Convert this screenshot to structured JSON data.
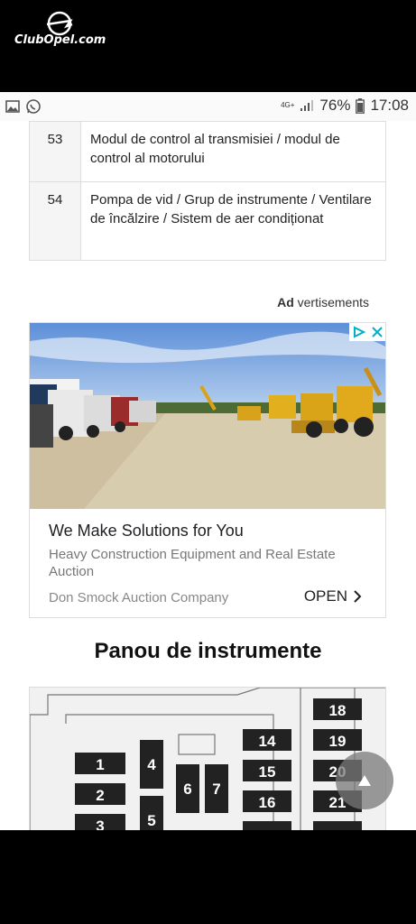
{
  "brand": {
    "logo_text": "ClubOpel.com"
  },
  "status_bar": {
    "network": "4G+",
    "battery": "76%",
    "time": "17:08"
  },
  "fuse_table": {
    "rows": [
      {
        "number": "53",
        "description": "Modul de control al transmisiei / modul de control al motorului"
      },
      {
        "number": "54",
        "description": "Pompa de vid / Grup de instrumente / Ventilare de încălzire / Sistem de aer condiționat"
      }
    ]
  },
  "ad": {
    "label_bold": "Ad",
    "label_rest": " vertisements",
    "title": "We Make Solutions for You",
    "subtitle": "Heavy Construction Equipment and Real Estate Auction",
    "company": "Don Smock Auction Company",
    "cta": "OPEN"
  },
  "section": {
    "title": "Panou de instrumente"
  },
  "diagram": {
    "fuse_labels": [
      "1",
      "2",
      "3",
      "4",
      "5",
      "6",
      "7",
      "14",
      "15",
      "16",
      "18",
      "19",
      "20",
      "21"
    ]
  }
}
